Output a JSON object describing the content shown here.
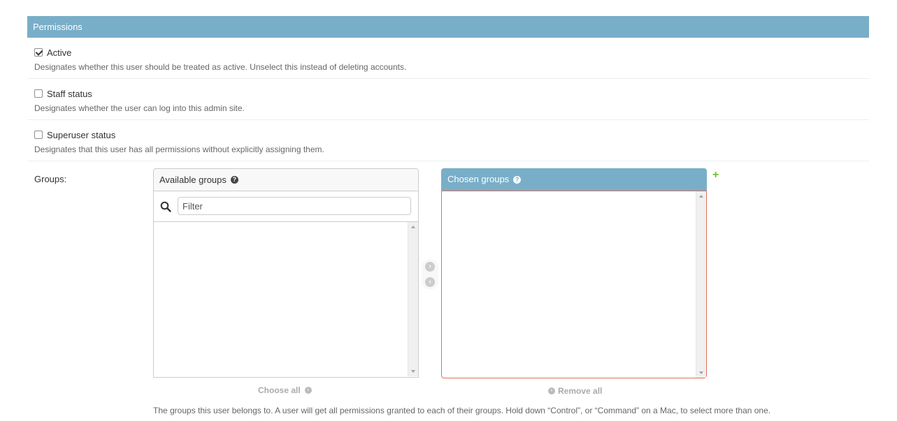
{
  "section": {
    "title": "Permissions"
  },
  "fields": {
    "active": {
      "label": "Active",
      "checked": true,
      "help": "Designates whether this user should be treated as active. Unselect this instead of deleting accounts."
    },
    "staff": {
      "label": "Staff status",
      "checked": false,
      "help": "Designates whether the user can log into this admin site."
    },
    "superuser": {
      "label": "Superuser status",
      "checked": false,
      "help": "Designates that this user has all permissions without explicitly assigning them."
    }
  },
  "groups": {
    "label": "Groups:",
    "available_title": "Available groups",
    "filter_placeholder": "Filter",
    "chosen_title": "Chosen groups",
    "choose_all": "Choose all",
    "remove_all": "Remove all",
    "help": "The groups this user belongs to. A user will get all permissions granted to each of their groups. Hold down “Control”, or “Command” on a Mac, to select more than one.",
    "add_icon": "+",
    "help_icon": "?"
  },
  "icons": {
    "search": "search-icon",
    "help": "help-icon",
    "add": "add-icon",
    "arrow_right": "arrow-right-icon",
    "arrow_left": "arrow-left-icon"
  },
  "colors": {
    "header": "#79aec8",
    "add": "#70bf2b",
    "focus_border": "#e0705b"
  }
}
